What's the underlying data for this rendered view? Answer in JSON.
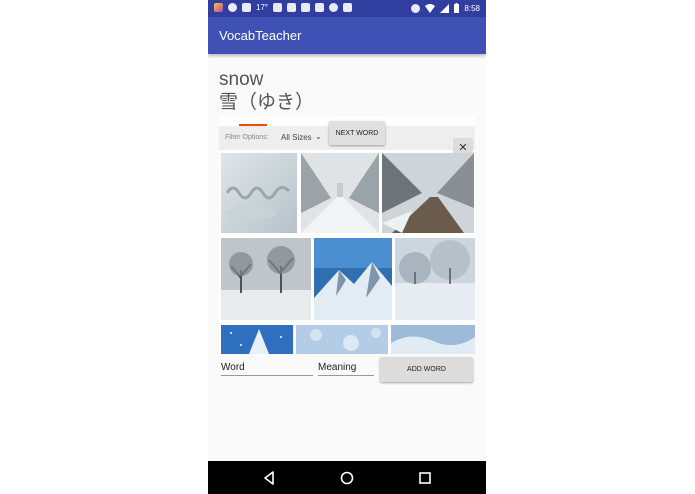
{
  "status_bar": {
    "temperature": "17°",
    "time": "8:58",
    "icons": [
      "app-icon",
      "chat-icon",
      "image-icon",
      "gmail-icon",
      "gmail-icon",
      "gmail-icon",
      "phone-icon",
      "android-icon",
      "inbox-icon",
      "alarm-icon",
      "wifi-icon",
      "signal-icon",
      "battery-icon"
    ]
  },
  "app_bar": {
    "title": "VocabTeacher"
  },
  "vocab": {
    "word": "snow",
    "reading": "雪（ゆき）"
  },
  "image_search": {
    "filter_label": "Filter Options:",
    "filter_value": "All Sizes",
    "next_word_label": "NEXT WORD",
    "close_symbol": "✕",
    "images": [
      "snow-writing-image",
      "snowy-road-trees-image",
      "snowy-lane-image",
      "snowy-trees-field-image",
      "snowy-mountains-image",
      "frosted-trees-image",
      "snowy-tree-sky-image",
      "snow-bokeh-image",
      "snow-waves-image"
    ]
  },
  "form": {
    "word_placeholder": "Word",
    "meaning_placeholder": "Meaning",
    "add_word_label": "ADD WORD"
  },
  "colors": {
    "primary": "#3F51B5",
    "primary_dark": "#303F9F",
    "accent": "#e65100"
  },
  "nav_bar": {
    "buttons": [
      "back-icon",
      "home-icon",
      "recents-icon"
    ]
  }
}
